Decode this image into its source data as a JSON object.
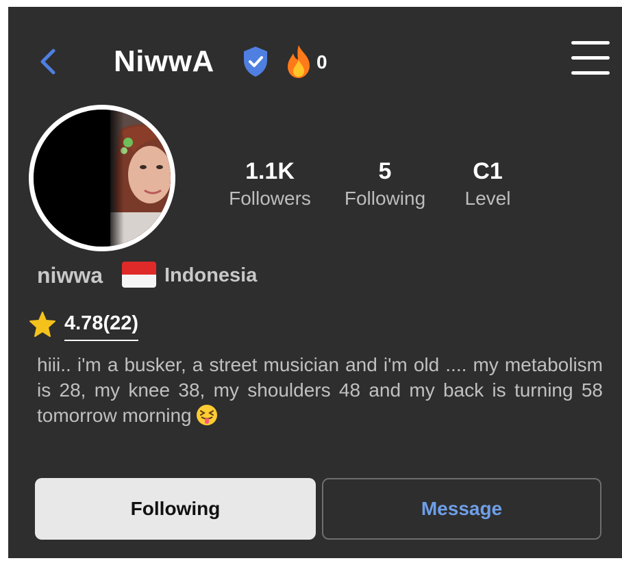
{
  "header": {
    "title": "NiwwA",
    "fire_count": "0",
    "icons": [
      "chevron-left-icon",
      "verified-shield-icon",
      "fire-icon",
      "hamburger-menu-icon"
    ],
    "accent_color": "#4f7fe0"
  },
  "stats": [
    {
      "value": "1.1K",
      "label": "Followers"
    },
    {
      "value": "5",
      "label": "Following"
    },
    {
      "value": "C1",
      "label": "Level"
    }
  ],
  "profile": {
    "username": "niwwa",
    "country": "Indonesia",
    "rating": "4.78(22)",
    "bio": "hiii.. i'm a busker, a street musician  and i'm old .... my metabolism is 28, my knee 38, my shoulders 48 and my back is turning 58 tomorrow morning"
  },
  "actions": {
    "following_label": "Following",
    "message_label": "Message"
  }
}
